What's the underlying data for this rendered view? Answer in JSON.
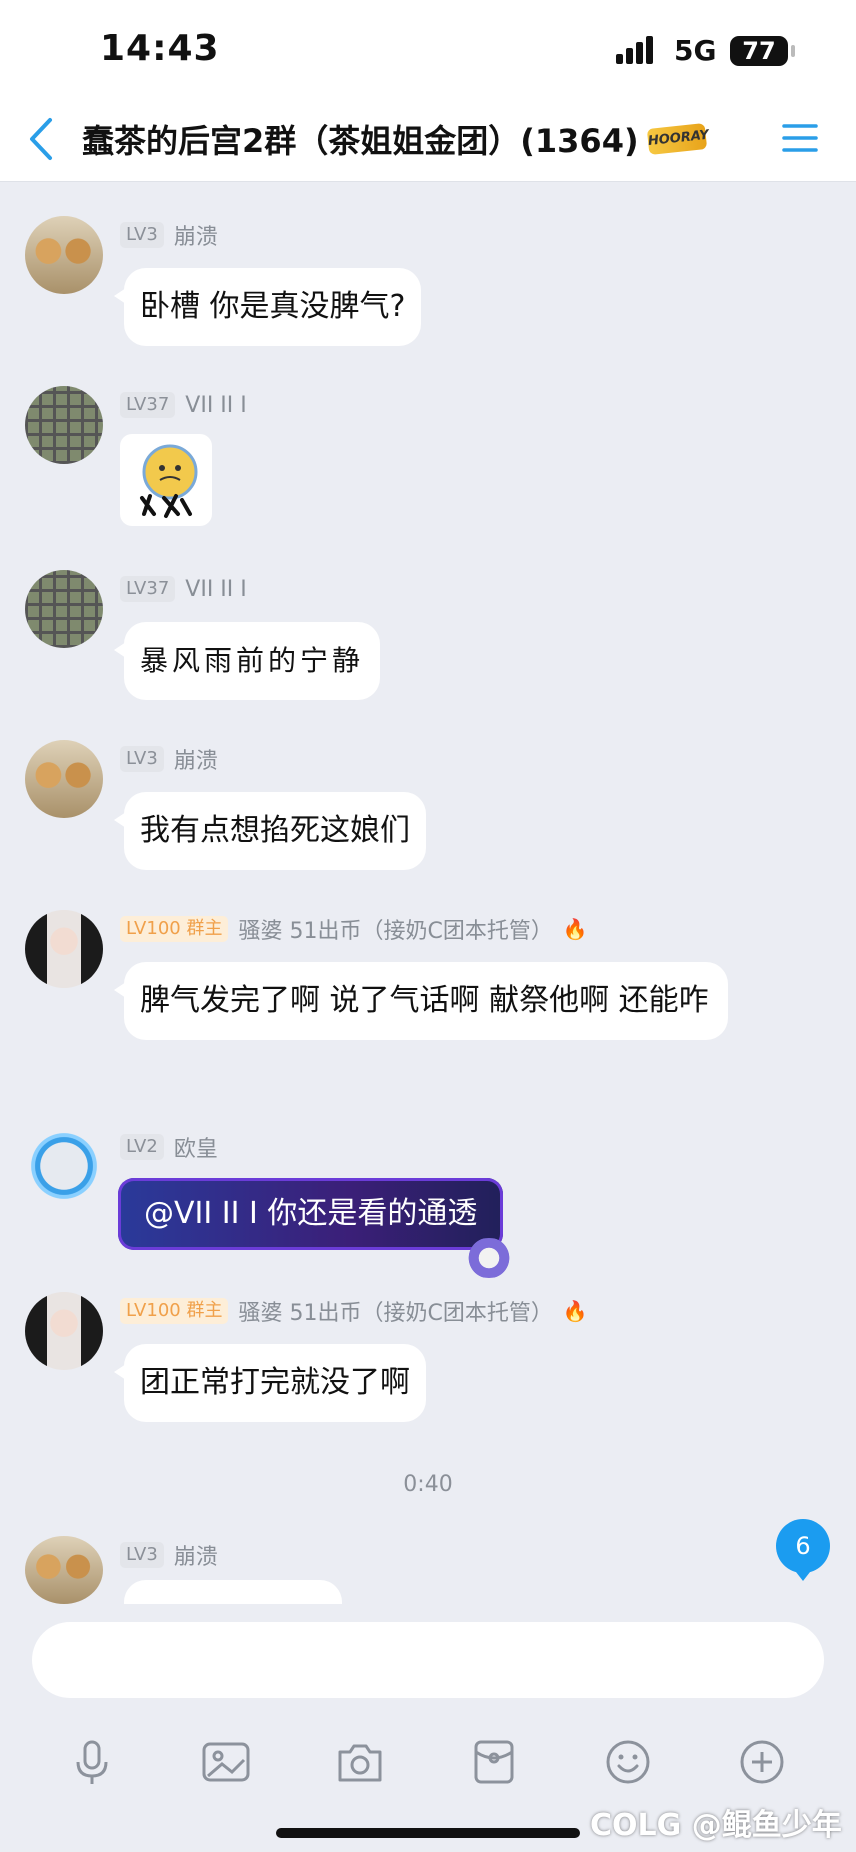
{
  "status_bar": {
    "time": "14:43",
    "network": "5G",
    "battery": "77"
  },
  "header": {
    "title": "蠢茶的后宫2群（茶姐姐金团）(1364)",
    "badge_text": "HOORAY"
  },
  "messages": [
    {
      "level": "LV3",
      "role": "",
      "nickname": "崩溃",
      "text": "卧槽 你是真没脾气?"
    },
    {
      "level": "LV37",
      "role": "",
      "nickname": "VII II I",
      "text": ""
    },
    {
      "level": "LV37",
      "role": "",
      "nickname": "VII II I",
      "text": "暴风雨前的宁静"
    },
    {
      "level": "LV3",
      "role": "",
      "nickname": "崩溃",
      "text": "我有点想掐死这娘们"
    },
    {
      "level": "LV100",
      "role": "群主",
      "nickname": "骚婆 51出币（接奶C团本托管）",
      "text": "脾气发完了啊  说了气话啊 献祭他啊 还能咋"
    },
    {
      "level": "LV2",
      "role": "",
      "nickname": "欧皇",
      "text": "@VII II I 你还是看的通透"
    },
    {
      "level": "LV100",
      "role": "群主",
      "nickname": "骚婆 51出币（接奶C团本托管）",
      "text": "团正常打完就没了啊"
    },
    {
      "level": "LV3",
      "role": "",
      "nickname": "崩溃",
      "text": ""
    }
  ],
  "timestamp": "0:40",
  "unread_count": "6",
  "watermark": "COLG @鲲鱼少年"
}
